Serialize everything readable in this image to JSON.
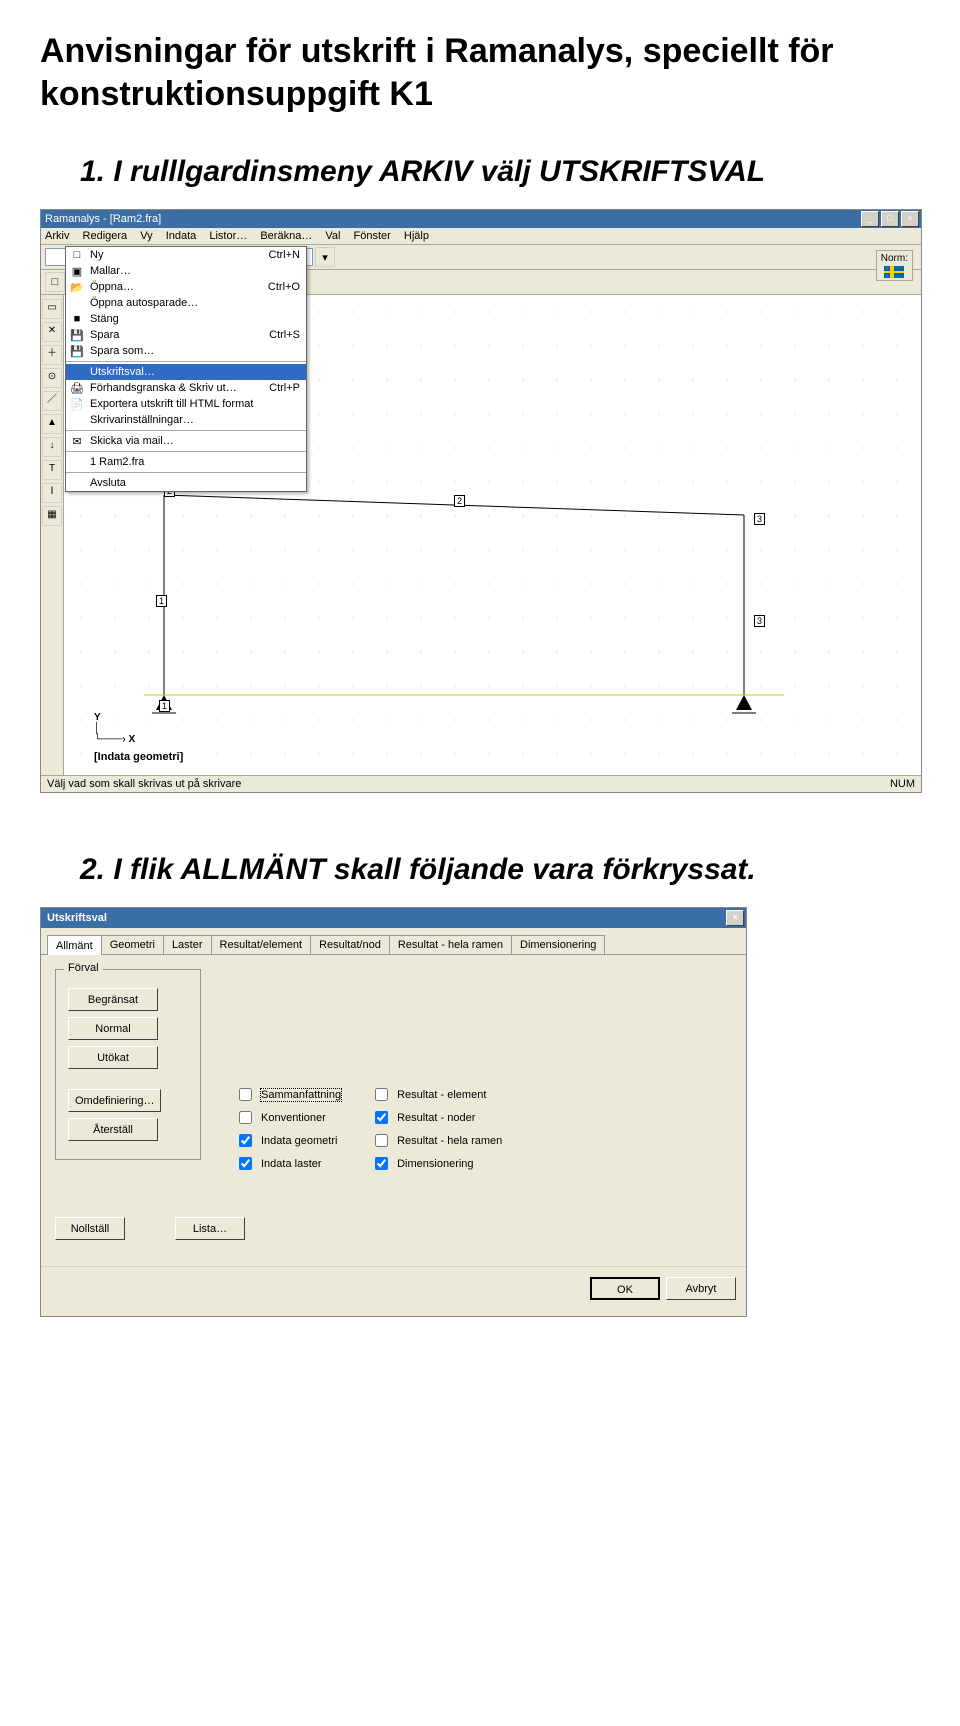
{
  "doc": {
    "title": "Anvisningar för utskrift i  Ramanalys, speciellt för konstruktionsuppgift K1",
    "step1": "1.  I rulllgardinsmeny ARKIV välj UTSKRIFTSVAL",
    "step2": "2.  I flik ALLMÄNT skall följande vara förkryssat."
  },
  "app": {
    "title": "Ramanalys - [Ram2.fra]",
    "winbtn_min": "_",
    "winbtn_max": "□",
    "winbtn_close": "×",
    "menubar": [
      "Arkiv",
      "Redigera",
      "Vy",
      "Indata",
      "Listor…",
      "Beräkna…",
      "Val",
      "Fönster",
      "Hjälp"
    ],
    "norm_label": "Norm:",
    "arkiv_menu": [
      {
        "label": "Ny",
        "accel": "Ctrl+N",
        "icon": "□"
      },
      {
        "label": "Mallar…",
        "icon": "▣"
      },
      {
        "label": "Öppna…",
        "accel": "Ctrl+O",
        "icon": "📂"
      },
      {
        "label": "Öppna autosparade…"
      },
      {
        "label": "Stäng",
        "icon": "■"
      },
      {
        "label": "Spara",
        "accel": "Ctrl+S",
        "icon": "💾"
      },
      {
        "label": "Spara som…",
        "icon": "💾"
      },
      {
        "sep": true
      },
      {
        "label": "Utskriftsval…",
        "sel": true
      },
      {
        "label": "Förhandsgranska & Skriv ut…",
        "accel": "Ctrl+P",
        "icon": "🖨"
      },
      {
        "label": "Exportera utskrift till HTML format",
        "icon": "📄"
      },
      {
        "label": "Skrivarinställningar…"
      },
      {
        "sep": true
      },
      {
        "label": "Skicka via mail…",
        "icon": "✉"
      },
      {
        "sep": true
      },
      {
        "label": "1 Ram2.fra"
      },
      {
        "sep": true
      },
      {
        "label": "Avsluta"
      }
    ],
    "node_labels": {
      "n1": "1",
      "n2": "2",
      "n3": "3",
      "e1": "1",
      "e2": "2",
      "e3": "3"
    },
    "axis_y": "Y",
    "axis_x": "X",
    "canvas_caption": "[Indata geometri]",
    "status_left": "Välj vad som skall skrivas ut på skrivare",
    "status_num": "NUM"
  },
  "dialog": {
    "title": "Utskriftsval",
    "close": "×",
    "tabs": [
      "Allmänt",
      "Geometri",
      "Laster",
      "Resultat/element",
      "Resultat/nod",
      "Resultat - hela ramen",
      "Dimensionering"
    ],
    "active_tab": "Allmänt",
    "group_legend": "Förval",
    "btn_begransat": "Begränsat",
    "btn_normal": "Normal",
    "btn_utokat": "Utökat",
    "btn_omdef": "Omdefiniering…",
    "btn_aterstall": "Återställ",
    "checks_left": [
      {
        "label": "Sammanfattning",
        "checked": false,
        "focus": true
      },
      {
        "label": "Konventioner",
        "checked": false
      },
      {
        "label": "Indata geometri",
        "checked": true
      },
      {
        "label": "Indata laster",
        "checked": true
      }
    ],
    "checks_right": [
      {
        "label": "Resultat - element",
        "checked": false
      },
      {
        "label": "Resultat - noder",
        "checked": true
      },
      {
        "label": "Resultat - hela ramen",
        "checked": false
      },
      {
        "label": "Dimensionering",
        "checked": true
      }
    ],
    "btn_nollstall": "Nollställ",
    "btn_lista": "Lista…",
    "btn_ok": "OK",
    "btn_avbryt": "Avbryt"
  }
}
